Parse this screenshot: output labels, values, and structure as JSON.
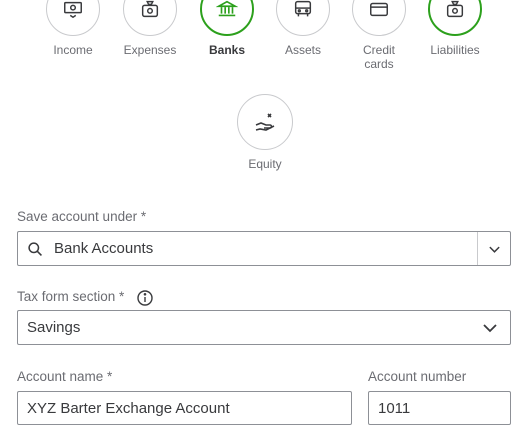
{
  "categories": [
    {
      "label": "Income",
      "icon": "cash-icon",
      "selected": false,
      "bold": false
    },
    {
      "label": "Expenses",
      "icon": "money-bag-icon",
      "selected": false,
      "bold": false
    },
    {
      "label": "Banks",
      "icon": "bank-icon",
      "selected": true,
      "bold": true
    },
    {
      "label": "Assets",
      "icon": "vehicle-icon",
      "selected": false,
      "bold": false
    },
    {
      "label": "Credit cards",
      "icon": "credit-card-icon",
      "selected": false,
      "bold": false
    },
    {
      "label": "Liabilities",
      "icon": "money-bag-icon",
      "selected": true,
      "bold": false
    },
    {
      "label": "Equity",
      "icon": "hand-coin-icon",
      "selected": false,
      "bold": false
    }
  ],
  "save_account_under": {
    "label": "Save account under *",
    "value": "Bank Accounts"
  },
  "tax_form_section": {
    "label": "Tax form section *",
    "value": "Savings"
  },
  "account_name": {
    "label": "Account name *",
    "value": "XYZ Barter Exchange Account"
  },
  "account_number": {
    "label": "Account number",
    "value": "1011"
  },
  "colors": {
    "accent": "#2ca01c",
    "border": "#8d9096",
    "text": "#393a3d",
    "muted": "#6b6c72"
  }
}
